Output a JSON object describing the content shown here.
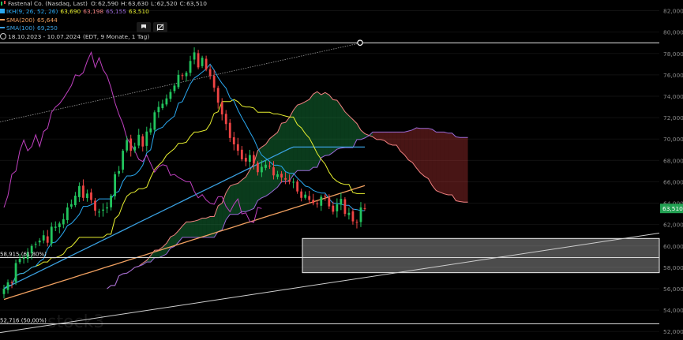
{
  "legend": {
    "instrument": "Fastenal Co. (Nasdaq, Last)",
    "ohlc": [
      {
        "k": "O:",
        "v": "62,590"
      },
      {
        "k": "H:",
        "v": "63,630"
      },
      {
        "k": "L:",
        "v": "62,520"
      },
      {
        "k": "C:",
        "v": "63,510"
      }
    ],
    "ichimoku": {
      "name": "IKH(9, 26, 52, 26)",
      "values": [
        "63,690",
        "63,198",
        "65,155",
        "63,510"
      ]
    },
    "sma200": {
      "name": "SMA(200)",
      "value": "65,644"
    },
    "sma100": {
      "name": "SMA(100)",
      "value": "69,250"
    },
    "range": "18.10.2023 - 10.07.2024",
    "range_info": "(EDT, 9 Monate, 1 Tag)"
  },
  "toolbar": {
    "icons": [
      "flag-icon",
      "hide-drawings-icon"
    ]
  },
  "watermark": "stock3",
  "colors": {
    "background": "#000000",
    "up": "#22c55e",
    "down": "#ef4444",
    "tenkan": "#2aa8f0",
    "kijun": "#e8f030",
    "chikou": "#c040c0",
    "span_a": "#f08080",
    "span_b": "#9a6ad8",
    "sma200": "#f0a060",
    "sma100": "#3aa0e0",
    "price_tag": "#22a052"
  },
  "chart_data": {
    "type": "candlestick",
    "x_range": [
      "18.10.2023",
      "10.07.2024"
    ],
    "ylim": [
      51.5,
      83
    ],
    "y_ticks": [
      "82,000",
      "80,000",
      "78,000",
      "76,000",
      "74,000",
      "72,000",
      "70,000",
      "68,000",
      "66,000",
      "64,000",
      "62,000",
      "60,000",
      "58,000",
      "56,000",
      "54,000",
      "52,000"
    ],
    "y_tick_values": [
      82,
      80,
      78,
      76,
      74,
      72,
      70,
      68,
      66,
      64,
      62,
      60,
      58,
      56,
      54,
      52
    ],
    "last_price": {
      "label": "63,510",
      "value": 63.51
    },
    "fib_levels": [
      {
        "label": "58,915 (61,80%)",
        "value": 58.915
      },
      {
        "label": "52,716 (50,00%)",
        "value": 52.716
      }
    ],
    "horizontal_line": 79.0,
    "support_zone": [
      57.5,
      60.7
    ],
    "closes": [
      56.0,
      56.6,
      56.6,
      58.4,
      58.8,
      58.9,
      59.4,
      60.0,
      60.2,
      60.5,
      61.0,
      60.3,
      61.8,
      61.8,
      62.1,
      62.5,
      63.6,
      63.9,
      64.7,
      65.6,
      64.5,
      64.9,
      64.3,
      63.3,
      63.2,
      63.4,
      63.6,
      64.7,
      66.7,
      67.0,
      68.9,
      69.9,
      68.9,
      69.3,
      70.4,
      69.3,
      70.7,
      71.0,
      72.5,
      73.0,
      73.3,
      73.8,
      74.4,
      75.0,
      76.0,
      75.9,
      76.2,
      77.3,
      78.1,
      76.7,
      77.6,
      76.5,
      75.9,
      74.8,
      73.4,
      72.3,
      71.4,
      70.1,
      69.5,
      68.9,
      68.1,
      67.9,
      68.5,
      67.7,
      66.9,
      67.4,
      67.6,
      67.5,
      66.6,
      66.7,
      66.4,
      66.2,
      66.0,
      66.0,
      65.1,
      64.5,
      64.8,
      64.3,
      64.0,
      63.9,
      64.6,
      64.6,
      63.7,
      63.2,
      63.9,
      64.4,
      63.0,
      63.1,
      62.3,
      62.2,
      63.6,
      63.5
    ],
    "series": [
      {
        "name": "SMA(200)",
        "value": 65.644
      },
      {
        "name": "SMA(100)",
        "value": 69.25
      },
      {
        "name": "IKH(9, 26, 52, 26)",
        "values": [
          63.69,
          63.198,
          65.155,
          63.51
        ]
      }
    ]
  }
}
